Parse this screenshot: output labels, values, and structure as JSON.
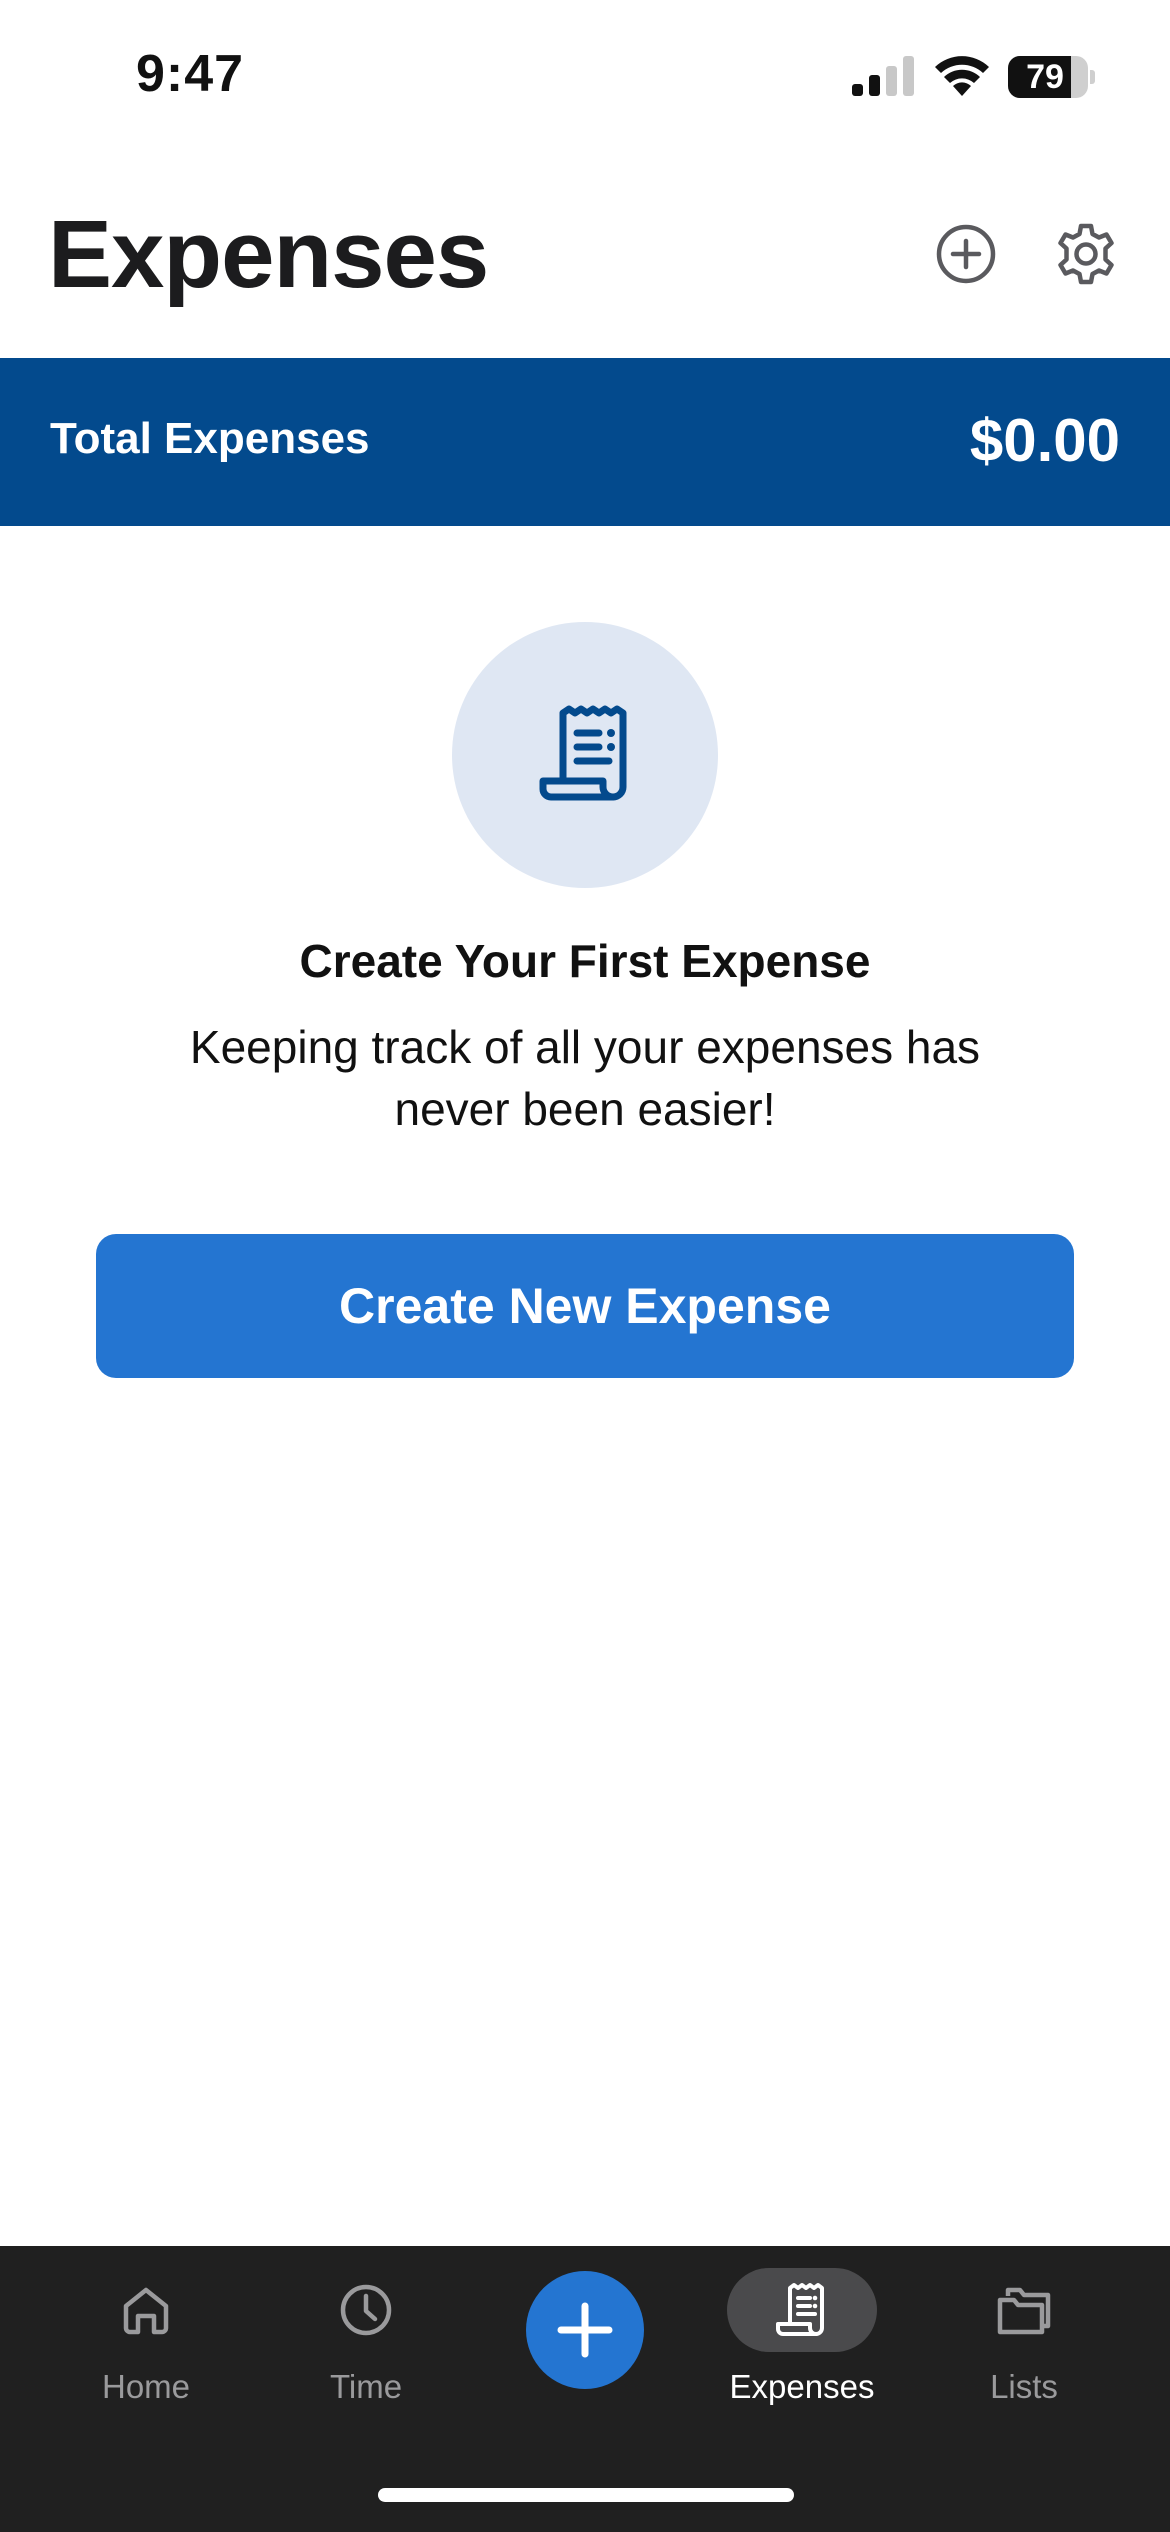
{
  "status_bar": {
    "time": "9:47",
    "battery_level": "79",
    "battery_fraction": 0.79
  },
  "header": {
    "title": "Expenses",
    "add_icon": "plus-circle-icon",
    "settings_icon": "gear-icon"
  },
  "summary": {
    "label": "Total Expenses",
    "amount": "$0.00"
  },
  "empty_state": {
    "icon": "receipt-icon",
    "title": "Create Your First Expense",
    "subtitle": "Keeping track of all your expenses has never been easier!",
    "button_label": "Create New Expense"
  },
  "tab_bar": {
    "tabs": [
      {
        "label": "Home",
        "icon": "house-icon",
        "active": false
      },
      {
        "label": "Time",
        "icon": "clock-icon",
        "active": false
      },
      {
        "label": "Expenses",
        "icon": "receipt-icon",
        "active": true
      },
      {
        "label": "Lists",
        "icon": "folder-icon",
        "active": false
      }
    ],
    "center_action_icon": "plus-icon"
  },
  "colors": {
    "brand_dark": "#034a8d",
    "brand_accent": "#2475d1",
    "icon_circle_bg": "#dfe7f3",
    "tab_bar_bg": "#202020"
  }
}
